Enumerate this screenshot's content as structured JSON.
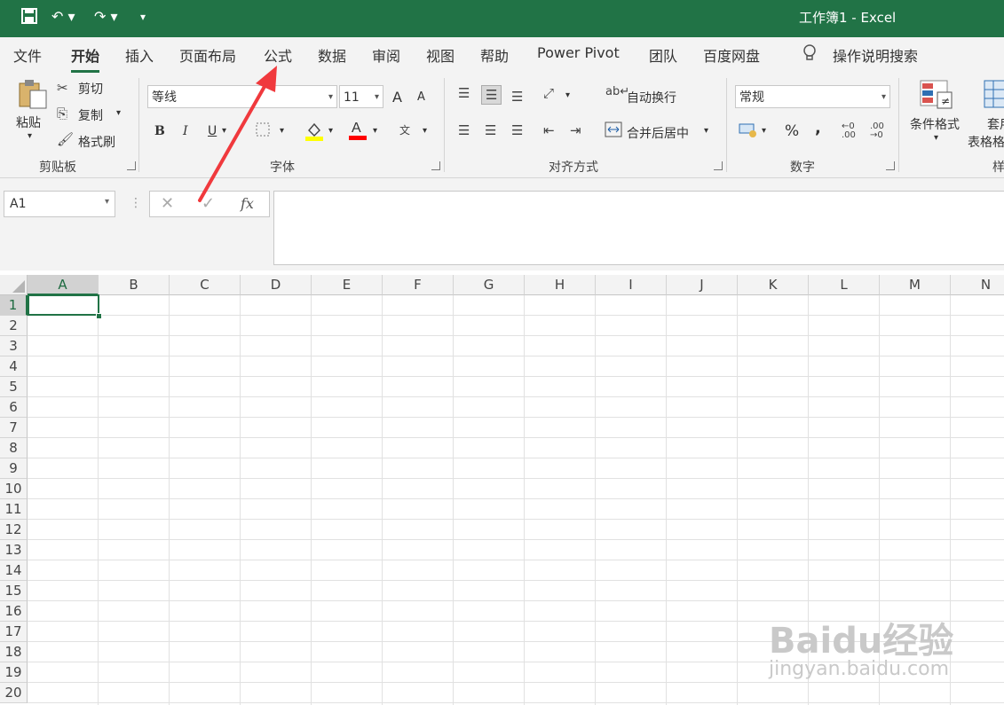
{
  "titlebar": {
    "title": "工作簿1 - Excel"
  },
  "tabs": [
    {
      "label": "文件"
    },
    {
      "label": "开始"
    },
    {
      "label": "插入"
    },
    {
      "label": "页面布局"
    },
    {
      "label": "公式"
    },
    {
      "label": "数据"
    },
    {
      "label": "审阅"
    },
    {
      "label": "视图"
    },
    {
      "label": "帮助"
    },
    {
      "label": "Power Pivot"
    },
    {
      "label": "团队"
    },
    {
      "label": "百度网盘"
    }
  ],
  "tell_me": "操作说明搜索",
  "ribbon": {
    "clipboard": {
      "paste": "粘贴",
      "cut": "剪切",
      "copy": "复制",
      "format_painter": "格式刷",
      "label": "剪贴板"
    },
    "font": {
      "name": "等线",
      "size": "11",
      "bold": "B",
      "italic": "I",
      "underline": "U",
      "label": "字体",
      "font_color_glyph": "A",
      "grow": "A",
      "shrink": "A"
    },
    "alignment": {
      "wrap": "自动换行",
      "merge": "合并后居中",
      "label": "对齐方式"
    },
    "number": {
      "format": "常规",
      "percent": "%",
      "comma": ",",
      "label": "数字"
    },
    "styles": {
      "conditional": "条件格式",
      "table_format_1": "套用",
      "table_format_2": "表格格",
      "label": "样"
    }
  },
  "namebox": "A1",
  "fx": "fx",
  "columns": [
    "A",
    "B",
    "C",
    "D",
    "E",
    "F",
    "G",
    "H",
    "I",
    "J",
    "K",
    "L",
    "M",
    "N"
  ],
  "rows": [
    "1",
    "2",
    "3",
    "4",
    "5",
    "6",
    "7",
    "8",
    "9",
    "10",
    "11",
    "12",
    "13",
    "14",
    "15",
    "16",
    "17",
    "18",
    "19",
    "20"
  ],
  "selected_cell": "A1",
  "watermark": {
    "line1": "Baidu经验",
    "line2": "jingyan.baidu.com"
  },
  "colors": {
    "accent": "#217346",
    "annotation_arrow": "#f0393d"
  }
}
